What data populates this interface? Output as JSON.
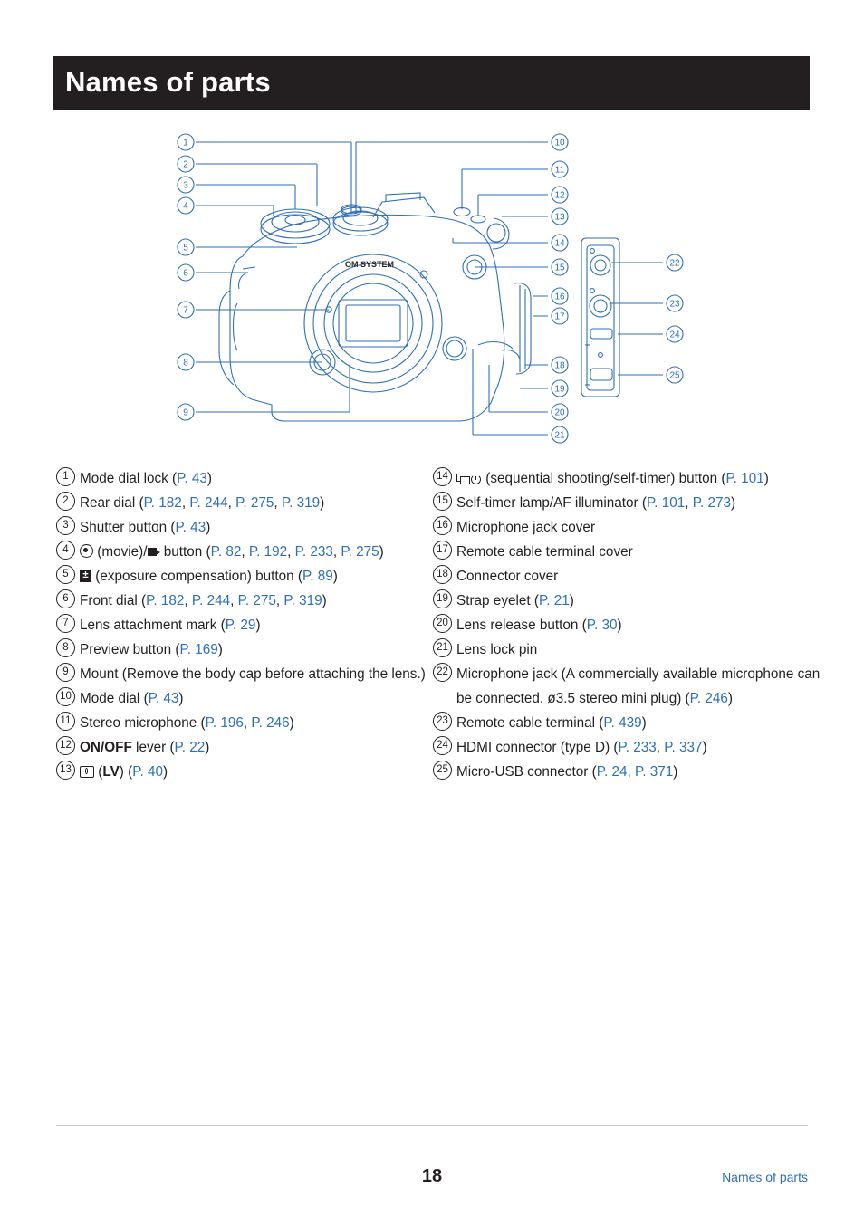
{
  "header": {
    "title": "Names of parts"
  },
  "figure": {
    "alt": "Front view line drawing of an OM SYSTEM mirrorless camera body with numbered callouts 1-21 and a side connector panel with callouts 22-25",
    "body_label": "OM SYSTEM",
    "callouts_left": [
      "1",
      "2",
      "3",
      "4",
      "5",
      "6",
      "7",
      "8",
      "9"
    ],
    "callouts_right": [
      "10",
      "11",
      "12",
      "13",
      "14",
      "15",
      "16",
      "17",
      "18",
      "19",
      "20",
      "21"
    ],
    "callouts_panel": [
      "22",
      "23",
      "24",
      "25"
    ]
  },
  "parts_left": [
    {
      "num": "1",
      "html": "Mode dial lock (<span class=\"ref\">P. 43</span>)"
    },
    {
      "num": "2",
      "html": "Rear dial (<span class=\"ref\">P. 182</span>, <span class=\"ref\">P. 244</span>, <span class=\"ref\">P. 275</span>, <span class=\"ref\">P. 319</span>)"
    },
    {
      "num": "3",
      "html": "Shutter button (<span class=\"ref\">P. 43</span>)"
    },
    {
      "num": "4",
      "html": "<span class=\"g-rec\"></span> (movie)/<span class=\"g-movie\"></span> button (<span class=\"ref\">P. 82</span>, <span class=\"ref\">P. 192</span>, <span class=\"ref\">P. 233</span>, <span class=\"ref\">P. 275</span>)"
    },
    {
      "num": "5",
      "html": "<span class=\"g-expcomp\"></span> (exposure compensation) button (<span class=\"ref\">P. 89</span>)"
    },
    {
      "num": "6",
      "html": "Front dial (<span class=\"ref\">P. 182</span>, <span class=\"ref\">P. 244</span>, <span class=\"ref\">P. 275</span>, <span class=\"ref\">P. 319</span>)"
    },
    {
      "num": "7",
      "html": "Lens attachment mark (<span class=\"ref\">P. 29</span>)"
    },
    {
      "num": "8",
      "html": "Preview button (<span class=\"ref\">P. 169</span>)"
    },
    {
      "num": "9",
      "html": "Mount (Remove the body cap before attaching the lens.)"
    },
    {
      "num": "10",
      "html": "Mode dial (<span class=\"ref\">P. 43</span>)"
    },
    {
      "num": "11",
      "html": "Stereo microphone (<span class=\"ref\">P. 196</span>, <span class=\"ref\">P. 246</span>)"
    },
    {
      "num": "12",
      "html": "<span class=\"bold\">ON/OFF</span> lever (<span class=\"ref\">P. 22</span>)"
    },
    {
      "num": "13",
      "html": "<span class=\"g-lv\"></span> (<span class=\"bold\">LV</span>) (<span class=\"ref\">P. 40</span>)"
    }
  ],
  "parts_right": [
    {
      "num": "14",
      "html": "<span class=\"g-seq\"></span><span class=\"g-timer\"></span> (sequential shooting/self-timer) button (<span class=\"ref\">P. 101</span>)"
    },
    {
      "num": "15",
      "html": "Self-timer lamp/AF illuminator (<span class=\"ref\">P. 101</span>, <span class=\"ref\">P. 273</span>)"
    },
    {
      "num": "16",
      "html": "Microphone jack cover"
    },
    {
      "num": "17",
      "html": "Remote cable terminal cover"
    },
    {
      "num": "18",
      "html": "Connector cover"
    },
    {
      "num": "19",
      "html": "Strap eyelet (<span class=\"ref\">P. 21</span>)"
    },
    {
      "num": "20",
      "html": "Lens release button (<span class=\"ref\">P. 30</span>)"
    },
    {
      "num": "21",
      "html": "Lens lock pin"
    },
    {
      "num": "22",
      "html": "Microphone jack (A commercially available microphone can be connected. &oslash;3.5 stereo mini plug) (<span class=\"ref\">P. 246</span>)"
    },
    {
      "num": "23",
      "html": "Remote cable terminal (<span class=\"ref\">P. 439</span>)"
    },
    {
      "num": "24",
      "html": "HDMI connector (type D) (<span class=\"ref\">P. 233</span>, <span class=\"ref\">P. 337</span>)"
    },
    {
      "num": "25",
      "html": "Micro-USB connector (<span class=\"ref\">P. 24</span>, <span class=\"ref\">P. 371</span>)"
    }
  ],
  "footer": {
    "page_number": "18",
    "running_head": "Names of parts"
  },
  "colors": {
    "link": "#2d6fb5",
    "banner": "#231f20",
    "figure_line": "#2d6fb5",
    "text": "#231f20"
  }
}
